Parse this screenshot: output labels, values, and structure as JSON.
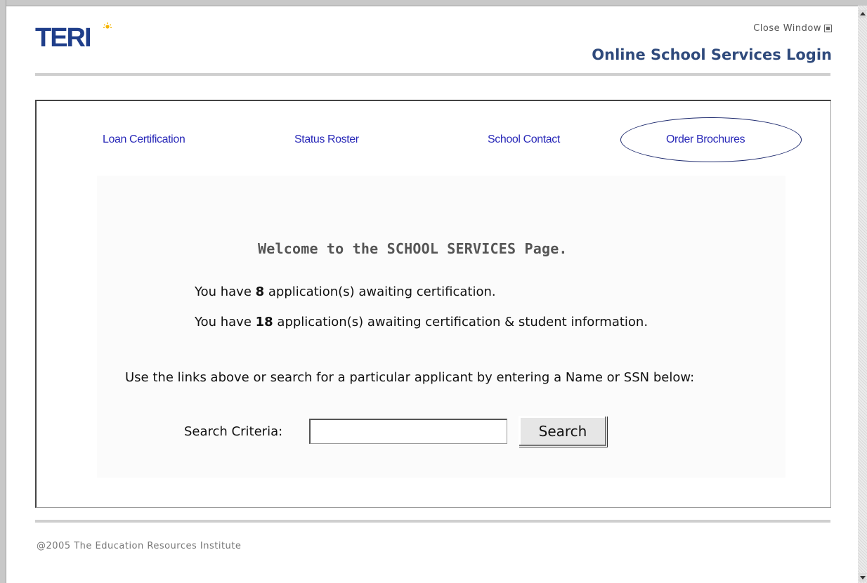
{
  "header": {
    "logo_text": "TERI",
    "close_window_label": "Close Window",
    "page_heading": "Online School Services Login"
  },
  "nav": {
    "items": [
      {
        "label": "Loan Certification"
      },
      {
        "label": "Status Roster"
      },
      {
        "label": "School Contact"
      },
      {
        "label": "Order Brochures"
      }
    ]
  },
  "main": {
    "welcome": "Welcome to the SCHOOL SERVICES Page.",
    "line1": {
      "prefix": "You have ",
      "count": "8",
      "suffix": " application(s) awaiting certification."
    },
    "line2": {
      "prefix": "You have ",
      "count": "18",
      "suffix": " application(s) awaiting certification & student information."
    },
    "instruction": "Use the links above or search for a particular applicant by entering a Name or SSN below:"
  },
  "search": {
    "label": "Search Criteria:",
    "value": "",
    "button_label": "Search"
  },
  "footer": {
    "copyright": "@2005 The Education Resources Institute"
  },
  "colors": {
    "link": "#2929b8",
    "heading": "#2f4a7c",
    "logo_blue": "#1f3e8a",
    "logo_sun": "#f5b400"
  }
}
